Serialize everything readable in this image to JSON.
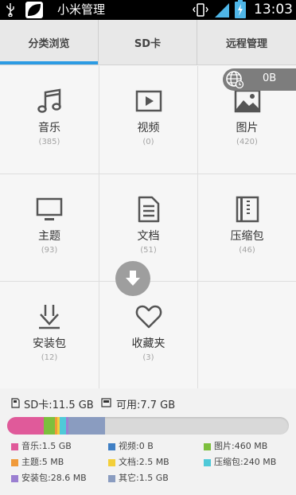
{
  "status_bar": {
    "app_name": "小米管理",
    "time": "13:03",
    "icons": [
      "usb-icon",
      "leaf-app-icon",
      "vibrate-icon",
      "signal-icon",
      "battery-charging-icon"
    ]
  },
  "tabs": [
    {
      "label": "分类浏览",
      "active": true
    },
    {
      "label": "SD卡",
      "active": false
    },
    {
      "label": "远程管理",
      "active": false
    }
  ],
  "remote": {
    "size": "0B",
    "icon": "globe-icon"
  },
  "categories": [
    {
      "label": "音乐",
      "count": "(385)",
      "icon": "music-note-icon"
    },
    {
      "label": "视频",
      "count": "(0)",
      "icon": "video-play-icon"
    },
    {
      "label": "图片",
      "count": "(420)",
      "icon": "picture-icon"
    },
    {
      "label": "主题",
      "count": "(93)",
      "icon": "monitor-icon"
    },
    {
      "label": "文档",
      "count": "(51)",
      "icon": "document-icon"
    },
    {
      "label": "压缩包",
      "count": "(46)",
      "icon": "archive-icon"
    },
    {
      "label": "安装包",
      "count": "(12)",
      "icon": "install-package-icon"
    },
    {
      "label": "收藏夹",
      "count": "(3)",
      "icon": "heart-icon"
    }
  ],
  "storage": {
    "sd_total": "SD卡:11.5 GB",
    "available": "可用:7.7 GB",
    "total_gb": 11.5,
    "colors": {
      "music": "#e05a9a",
      "video": "#3f7fc4",
      "pictures": "#7dbf3d",
      "themes": "#f09a3a",
      "docs": "#f3cf3a",
      "archives": "#4fc9d8",
      "apks": "#9b7fd1",
      "other": "#8a9cc0"
    },
    "legend": [
      {
        "key": "music",
        "label": "音乐:1.5 GB",
        "gb": 1.5
      },
      {
        "key": "video",
        "label": "视频:0 B",
        "gb": 0
      },
      {
        "key": "pictures",
        "label": "图片:460 MB",
        "gb": 0.46
      },
      {
        "key": "themes",
        "label": "主题:5 MB",
        "gb": 0.005
      },
      {
        "key": "docs",
        "label": "文档:2.5 MB",
        "gb": 0.0025
      },
      {
        "key": "archives",
        "label": "压缩包:240 MB",
        "gb": 0.24
      },
      {
        "key": "apks",
        "label": "安装包:28.6 MB",
        "gb": 0.0286
      },
      {
        "key": "other",
        "label": "其它:1.5 GB",
        "gb": 1.5
      }
    ]
  }
}
